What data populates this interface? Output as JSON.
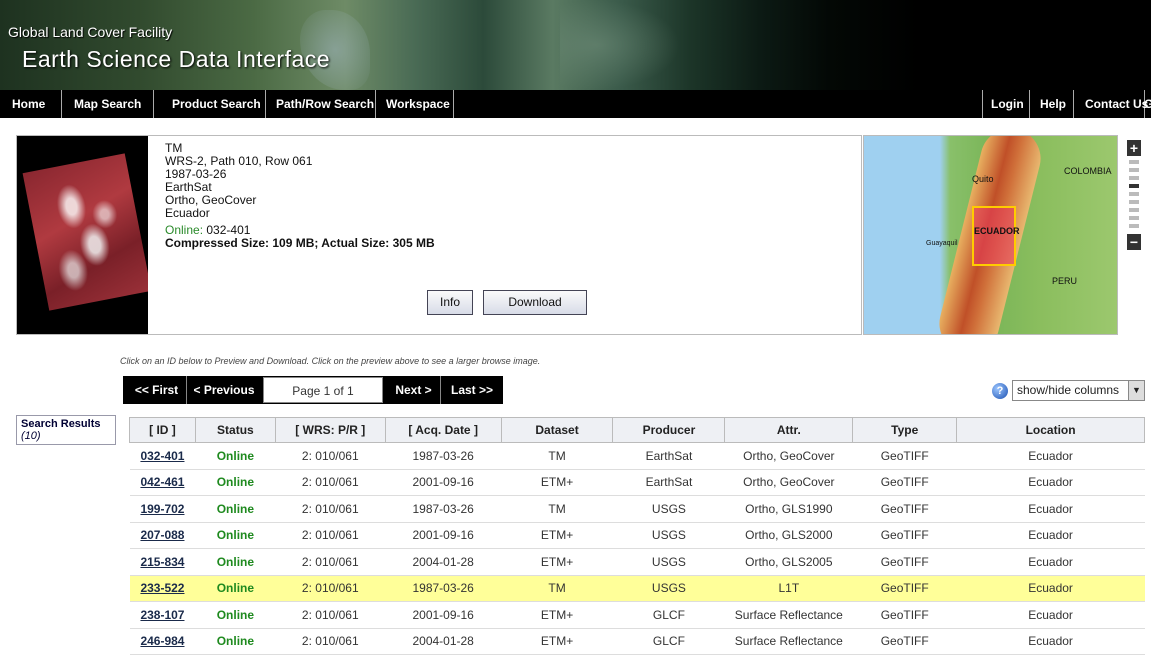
{
  "banner": {
    "small_title": "Global Land Cover Facility",
    "big_title": "Earth Science Data Interface"
  },
  "nav": {
    "home": "Home",
    "map_search": "Map Search",
    "product_search": "Product Search",
    "path_row_search": "Path/Row Search",
    "workspace": "Workspace",
    "login": "Login",
    "help": "Help",
    "contact_us": "Contact Us",
    "glcf": "GLC"
  },
  "preview": {
    "sensor": "TM",
    "path_row": "WRS-2, Path 010, Row 061",
    "date": "1987-03-26",
    "producer": "EarthSat",
    "attributes": "Ortho, GeoCover",
    "location": "Ecuador",
    "online_label": "Online:",
    "online_id": "032-401",
    "size": "Compressed Size: 109 MB; Actual Size: 305 MB",
    "info_button": "Info",
    "download_button": "Download"
  },
  "map": {
    "labels": {
      "colombia": "COLOMBIA",
      "quito": "Quito",
      "ecuador": "ECUADOR",
      "guayaquil": "Guayaquil",
      "peru": "PERU"
    },
    "zoom_in": "+",
    "zoom_out": "−"
  },
  "instruction": "Click on an ID below to Preview and Download. Click on the preview above to see a larger browse image.",
  "pager": {
    "first": "<< First",
    "previous": "< Previous",
    "page": "Page 1 of 1",
    "next": "Next >",
    "last": "Last >>"
  },
  "columns_control": {
    "help": "?",
    "label": "show/hide columns"
  },
  "search_results": {
    "label": "Search Results",
    "count": "(10)"
  },
  "table": {
    "headers": [
      "[ ID ]",
      "Status",
      "[ WRS: P/R ]",
      "[ Acq. Date ]",
      "Dataset",
      "Producer",
      "Attr.",
      "Type",
      "Location"
    ],
    "rows": [
      [
        "032-401",
        "Online",
        "2: 010/061",
        "1987-03-26",
        "TM",
        "EarthSat",
        "Ortho, GeoCover",
        "GeoTIFF",
        "Ecuador"
      ],
      [
        "042-461",
        "Online",
        "2: 010/061",
        "2001-09-16",
        "ETM+",
        "EarthSat",
        "Ortho, GeoCover",
        "GeoTIFF",
        "Ecuador"
      ],
      [
        "199-702",
        "Online",
        "2: 010/061",
        "1987-03-26",
        "TM",
        "USGS",
        "Ortho, GLS1990",
        "GeoTIFF",
        "Ecuador"
      ],
      [
        "207-088",
        "Online",
        "2: 010/061",
        "2001-09-16",
        "ETM+",
        "USGS",
        "Ortho, GLS2000",
        "GeoTIFF",
        "Ecuador"
      ],
      [
        "215-834",
        "Online",
        "2: 010/061",
        "2004-01-28",
        "ETM+",
        "USGS",
        "Ortho, GLS2005",
        "GeoTIFF",
        "Ecuador"
      ],
      [
        "233-522",
        "Online",
        "2: 010/061",
        "1987-03-26",
        "TM",
        "USGS",
        "L1T",
        "GeoTIFF",
        "Ecuador"
      ],
      [
        "238-107",
        "Online",
        "2: 010/061",
        "2001-09-16",
        "ETM+",
        "GLCF",
        "Surface Reflectance",
        "GeoTIFF",
        "Ecuador"
      ],
      [
        "246-984",
        "Online",
        "2: 010/061",
        "2004-01-28",
        "ETM+",
        "GLCF",
        "Surface Reflectance",
        "GeoTIFF",
        "Ecuador"
      ]
    ],
    "highlighted_row_id": "233-522",
    "highlight_color": "#ffff99",
    "status_color": "#1f8a1f"
  }
}
